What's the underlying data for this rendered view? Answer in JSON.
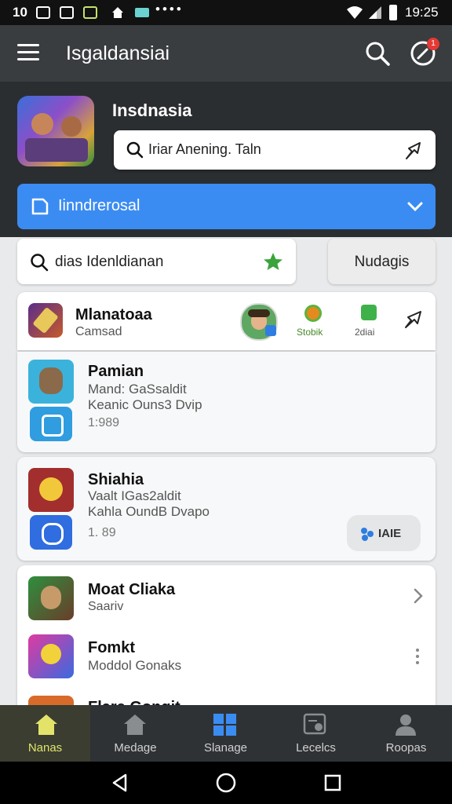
{
  "status": {
    "left_text": "10",
    "time": "19:25"
  },
  "appbar": {
    "title": "Isgaldansiai",
    "notification_count": "1"
  },
  "header": {
    "title": "Insdnasia",
    "search_text": "Iriar Anening. Taln",
    "banner_label": "Iinndrerosal"
  },
  "toolbar": {
    "search_text": "dias Idenldianan",
    "button_label": "Nudagis"
  },
  "featured": {
    "name": "Mlanatoaa",
    "subtitle": "Camsad",
    "badge1_label": "Stobik",
    "badge2_label": "2diai"
  },
  "apps": [
    {
      "name": "Pamian",
      "line1": "Mand: GaSsaldit",
      "line2": "Keanic Ouns3 Dvip",
      "meta": "1:989"
    },
    {
      "name": "Shiahia",
      "line1": "Vaalt IGas2aldit",
      "line2": "Kahla OundB Dvapo",
      "meta": "1. 89",
      "action_label": "IAIE"
    }
  ],
  "list": [
    {
      "name": "Moat Cliaka",
      "sub": "Saariv"
    },
    {
      "name": "Fomkt",
      "sub": "Moddol Gonaks"
    },
    {
      "name": "Flare Gongit"
    }
  ],
  "nav": [
    {
      "label": "Nanas"
    },
    {
      "label": "Medage"
    },
    {
      "label": "Slanage"
    },
    {
      "label": "Lecelcs"
    },
    {
      "label": "Roopas"
    }
  ],
  "colors": {
    "accent": "#3b8cf2",
    "nav_active": "#e3e36a",
    "badge": "#e53935"
  }
}
